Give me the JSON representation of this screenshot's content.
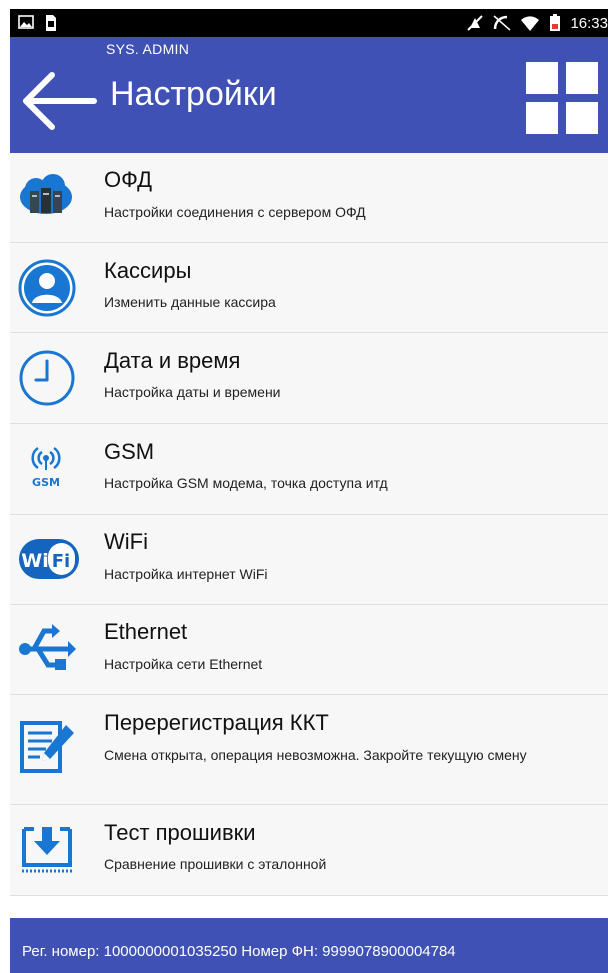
{
  "status": {
    "time": "16:33"
  },
  "header": {
    "user": "SYS. ADMIN",
    "title": "Настройки"
  },
  "items": [
    {
      "title": "ОФД",
      "desc": "Настройки соединения с сервером ОФД",
      "icon": "cloud-server-icon"
    },
    {
      "title": "Кассиры",
      "desc": "Изменить данные кассира",
      "icon": "user-icon"
    },
    {
      "title": "Дата и время",
      "desc": "Настройка даты и времени",
      "icon": "clock-icon"
    },
    {
      "title": "GSM",
      "desc": "Настройка GSM модема, точка доступа итд",
      "icon": "gsm-icon",
      "icon_label": "GSM"
    },
    {
      "title": "WiFi",
      "desc": "Настройка интернет WiFi",
      "icon": "wifi-icon",
      "icon_label_1": "Wi",
      "icon_label_2": "Fi"
    },
    {
      "title": "Ethernet",
      "desc": "Настройка сети Ethernet",
      "icon": "usb-network-icon"
    },
    {
      "title": "Перерегистрация ККТ",
      "desc": "Смена открыта, операция невозможна. Закройте текущую смену",
      "icon": "edit-document-icon"
    },
    {
      "title": "Тест прошивки",
      "desc": "Сравнение прошивки с эталонной",
      "icon": "firmware-download-icon"
    }
  ],
  "footer": {
    "info": "Рег. номер: 1000000001035250  Номер ФН: 9999078900004784"
  },
  "colors": {
    "primary": "#3f51b5",
    "icon_blue": "#1976d2"
  }
}
